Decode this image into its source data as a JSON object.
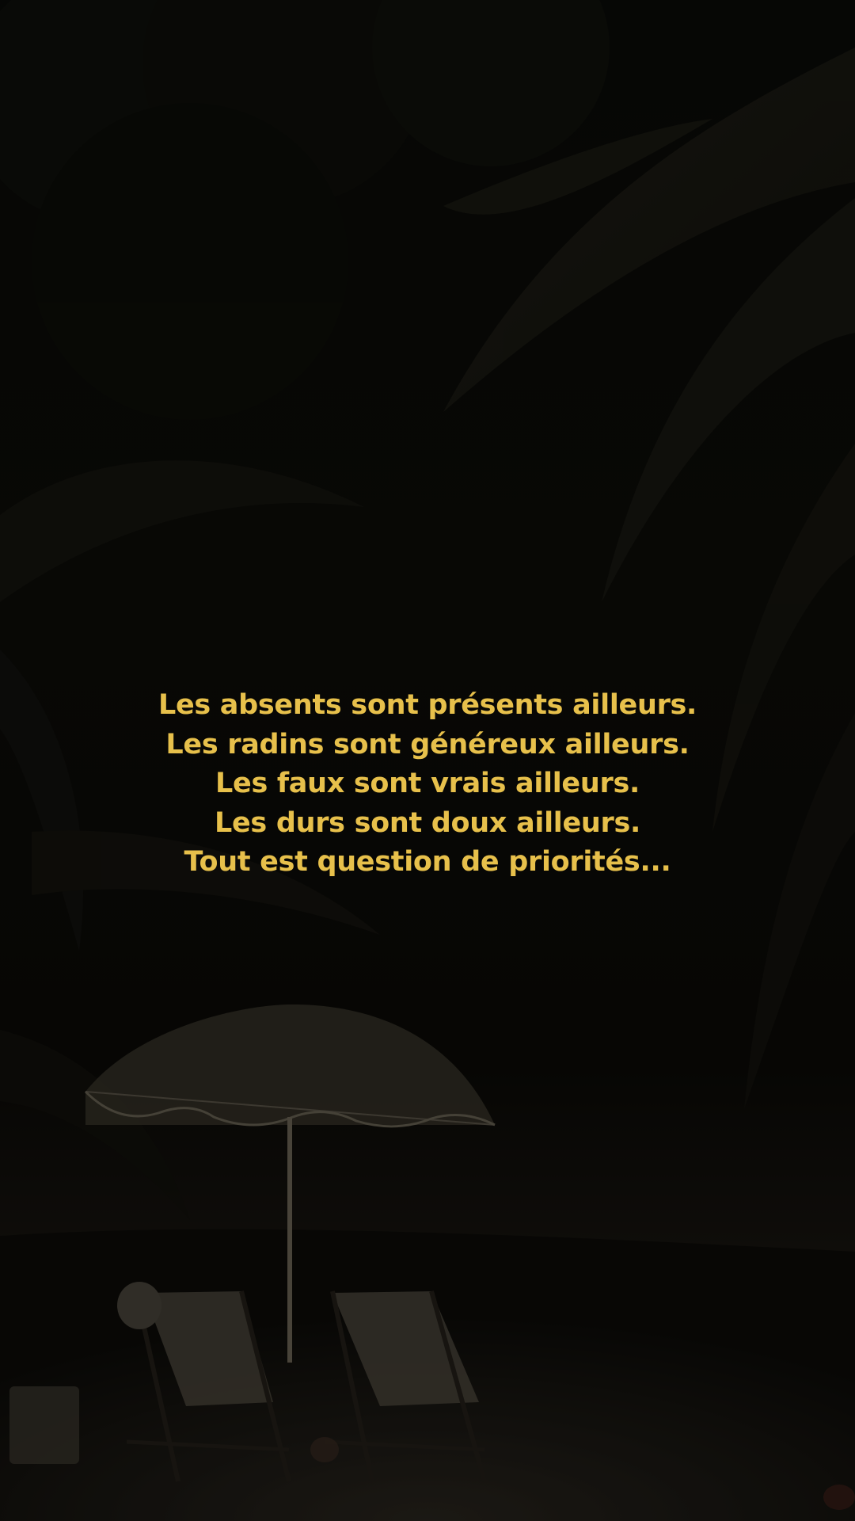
{
  "quote": {
    "lines": [
      "Les absents sont présents ailleurs.",
      "Les radins sont généreux ailleurs.",
      "Les faux sont vrais ailleurs.",
      "Les durs sont doux ailleurs.",
      "Tout est question de priorités..."
    ],
    "color": "#e7c04b"
  },
  "scene": {
    "background_color": "#0b0a07",
    "elements": [
      "palm-fronds",
      "beach-umbrella",
      "beach-chairs",
      "sand"
    ]
  }
}
